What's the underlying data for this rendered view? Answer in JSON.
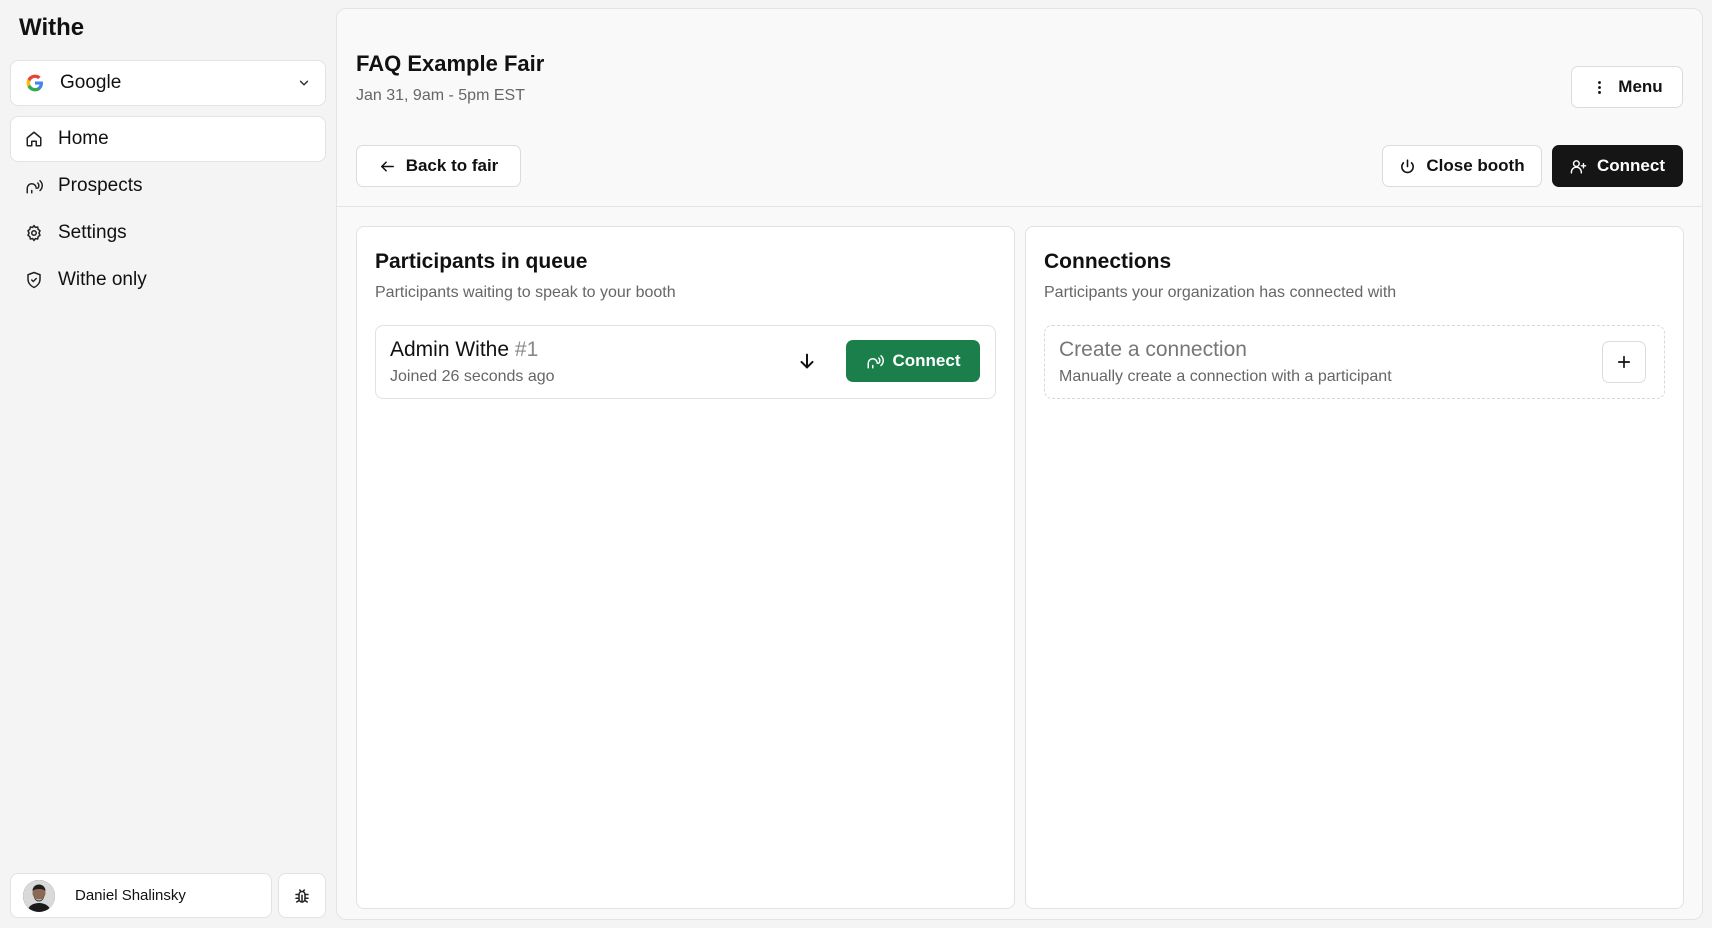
{
  "app": {
    "brand": "Withe"
  },
  "sidebar": {
    "org": {
      "name": "Google",
      "icon": "google-logo-icon"
    },
    "items": [
      {
        "label": "Home",
        "icon": "home-icon",
        "active": true
      },
      {
        "label": "Prospects",
        "icon": "speaking-head-icon",
        "active": false
      },
      {
        "label": "Settings",
        "icon": "gear-icon",
        "active": false
      },
      {
        "label": "Withe only",
        "icon": "shield-icon",
        "active": false
      }
    ],
    "user": {
      "name": "Daniel Shalinsky"
    },
    "debug_icon": "bug-icon"
  },
  "header": {
    "title": "FAQ Example Fair",
    "date": "Jan 31, 9am - 5pm EST",
    "menu_label": "Menu",
    "back_label": "Back to fair",
    "close_booth_label": "Close booth",
    "connect_label": "Connect"
  },
  "queue": {
    "title": "Participants in queue",
    "subtitle": "Participants waiting to speak to your booth",
    "items": [
      {
        "name": "Admin Withe",
        "number": "#1",
        "joined": "Joined 26 seconds ago",
        "connect_label": "Connect"
      }
    ]
  },
  "connections": {
    "title": "Connections",
    "subtitle": "Participants your organization has connected with",
    "create_title": "Create a connection",
    "create_subtitle": "Manually create a connection with a participant"
  },
  "colors": {
    "accent_green": "#1a7f4b",
    "dark_button": "#151515",
    "background": "#f4f4f4"
  }
}
